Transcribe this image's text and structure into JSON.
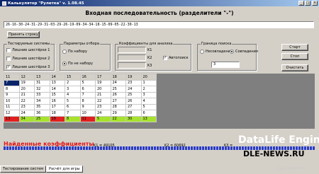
{
  "window": {
    "title": "Калькулятор \"Рулетка\" v. 1.08.45",
    "controls": [
      "_",
      "□",
      "×"
    ]
  },
  "heading": "Входная последовательность (разделители \"-\")",
  "sequence": "26-16-30-24-31-29-31-03-29-26-19-09-34-34-18-15-09-05-22-30-13",
  "buttons": {
    "accept": "Принять строку",
    "start": "Старт",
    "stop": "Стоп",
    "clear": "Очистить"
  },
  "systems": {
    "title": "Тестируемые системы",
    "items": [
      {
        "label": "Лишние шестёрки 1",
        "checked": false
      },
      {
        "label": "Лишние шестёрки 2",
        "checked": false
      },
      {
        "label": "Лишние шестёрки 3",
        "checked": true
      }
    ]
  },
  "selection": {
    "title": "Параметры отбора",
    "items": [
      {
        "label": "По набору",
        "selected": false
      },
      {
        "label": "По не набору",
        "selected": true
      }
    ]
  },
  "coefficients": {
    "title": "Коэффициенты для анализа",
    "labels": [
      "K1",
      "K2",
      "K3"
    ],
    "auto_label": "Автопоиск",
    "auto_checked": true
  },
  "search_bound": {
    "title": "Граница поиска",
    "items": [
      {
        "label": "Несовпадения",
        "selected": false
      },
      {
        "label": "Совпадения",
        "selected": true
      }
    ],
    "value": "3"
  },
  "grid": {
    "header": [
      "11",
      "12",
      "13",
      "14",
      "15",
      "16",
      "17",
      "18",
      "19",
      "20"
    ],
    "rows": [
      [
        "7",
        "19",
        "31",
        "13",
        "2",
        "5",
        "19",
        "24",
        "23",
        "1"
      ],
      [
        "8",
        "20",
        "32",
        "14",
        "3",
        "6",
        "20",
        "25",
        "24",
        "2"
      ],
      [
        "9",
        "21",
        "33",
        "15",
        "4",
        "7",
        "21",
        "26",
        "25",
        "3"
      ],
      [
        "10",
        "22",
        "34",
        "16",
        "5",
        "8",
        "22",
        "27",
        "26",
        "4"
      ],
      [
        "11",
        "23",
        "35",
        "17",
        "6",
        "9",
        "23",
        "28",
        "27",
        "5"
      ],
      [
        "12",
        "24",
        "36",
        "18",
        "7",
        "10",
        "24",
        "29",
        "28",
        "6"
      ],
      [
        "13",
        "34",
        "25",
        "19",
        "8",
        "11",
        "5",
        "22",
        "30",
        "13"
      ]
    ],
    "row_styles": [
      "sel-first",
      "",
      "",
      "",
      "",
      "",
      "highlight"
    ],
    "highlight_colors": [
      "red",
      "green",
      "green",
      "red",
      "green",
      "red",
      "green",
      "green",
      "green",
      "green"
    ]
  },
  "found": {
    "title": "Найденные коэффициенты",
    "k1": "K1 = 49105",
    "k2": "K2 = 60692",
    "k3": "K3 ="
  },
  "tabs": [
    {
      "label": "Тестирование систем",
      "active": false
    },
    {
      "label": "Расчёт для игры",
      "active": true
    }
  ],
  "watermark": {
    "brand": "DataLife Engine",
    "site": "DLE-NEWS.RU",
    "small": "Spy.0-program.ru"
  },
  "colors": {
    "title_bar": "#0a246a",
    "found_title": "#e01818",
    "progress": "#2a3cc8",
    "selected_cell": "#0a246a",
    "red_cell": "#e02020",
    "green_cell": "#a6e22e"
  }
}
